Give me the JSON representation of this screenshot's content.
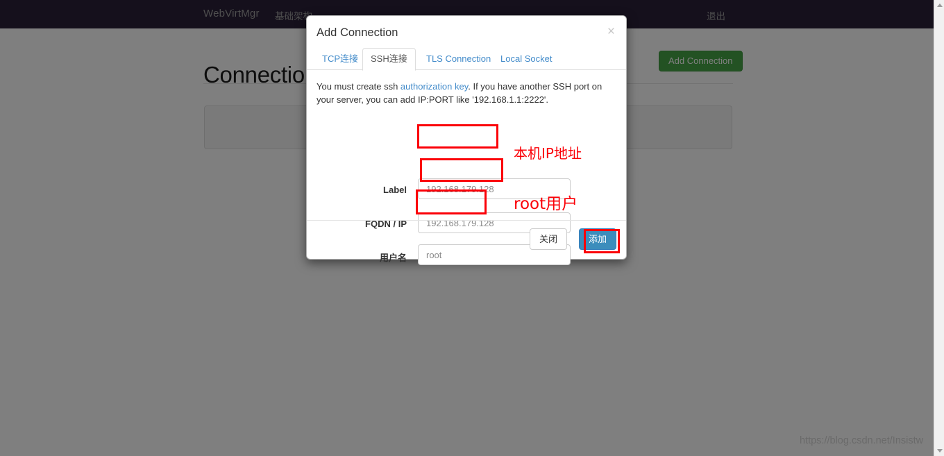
{
  "navbar": {
    "brand": "WebVirtMgr",
    "infrastructure": "基础架构",
    "logout": "退出"
  },
  "page": {
    "title": "Connections",
    "add_connection_button": "Add Connection",
    "watermark": "https://blog.csdn.net/Insistw"
  },
  "modal": {
    "title": "Add Connection",
    "close_icon": "×",
    "tabs": [
      {
        "label": "TCP连接",
        "active": false
      },
      {
        "label": "SSH连接",
        "active": true
      },
      {
        "label": "TLS Connection",
        "active": false
      },
      {
        "label": "Local Socket",
        "active": false
      }
    ],
    "help": {
      "before_link": "You must create ssh ",
      "link": "authorization key",
      "after_link": ". If you have another SSH port on your server, you can add IP:PORT like '192.168.1.1:2222'."
    },
    "fields": [
      {
        "label": "Label",
        "value": "192.168.179.128",
        "placeholder": ""
      },
      {
        "label": "FQDN / IP",
        "value": "192.168.179.128",
        "placeholder": ""
      },
      {
        "label": "用户名",
        "value": "root",
        "placeholder": ""
      }
    ],
    "footer": {
      "close_label": "关闭",
      "submit_label": "添加"
    }
  },
  "annotations": [
    {
      "text": "本机IP地址"
    },
    {
      "text": "root用户"
    }
  ],
  "colors": {
    "navbar": "#2a2139",
    "backdrop": "#808080",
    "accent_link": "#428bca",
    "submit": "#3c8dbc",
    "add_connection": "#46a546",
    "annotation_red": "#fb0007"
  }
}
